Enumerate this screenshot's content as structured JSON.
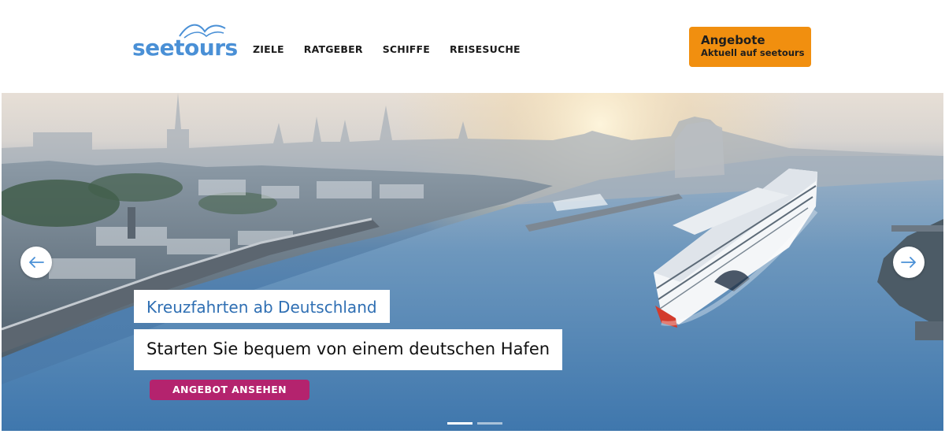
{
  "header": {
    "logo_text": "seetours",
    "nav": [
      {
        "label": "ZIELE"
      },
      {
        "label": "RATGEBER"
      },
      {
        "label": "SCHIFFE"
      },
      {
        "label": "REISESUCHE"
      }
    ],
    "offer_button": {
      "title": "Angebote",
      "subtitle": "Aktuell auf seetours"
    }
  },
  "colors": {
    "brand_blue": "#4a90d6",
    "offer_orange": "#f18f0f",
    "cta_magenta": "#b4236e",
    "caption_blue": "#2f6fb3"
  },
  "hero": {
    "caption_title": "Kreuzfahrten ab Deutschland",
    "caption_subtitle": "Starten Sie bequem von einem deutschen Hafen",
    "cta_label": "ANGEBOT ANSEHEN",
    "arrows": {
      "prev_icon": "arrow-left-icon",
      "next_icon": "arrow-right-icon"
    },
    "slides_total": 2,
    "active_slide": 1
  }
}
